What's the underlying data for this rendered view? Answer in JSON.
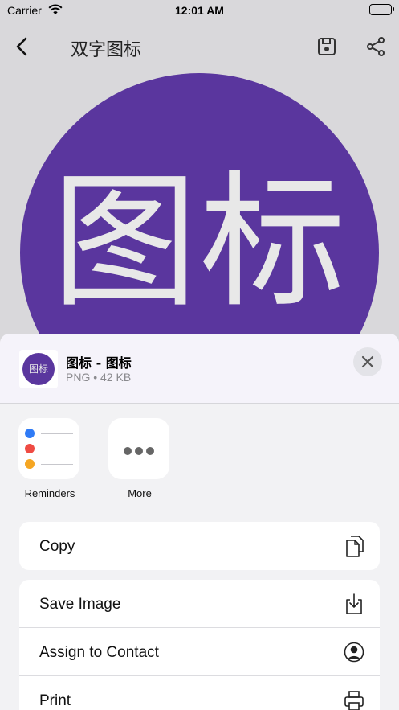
{
  "status_bar": {
    "carrier": "Carrier",
    "time": "12:01 AM"
  },
  "nav": {
    "title": "双字图标",
    "icons": [
      "chevron-left-icon",
      "save-icon",
      "share-icon"
    ]
  },
  "preview": {
    "glyphs": "图标",
    "circle_color": "#5a369e"
  },
  "share_sheet": {
    "file_name": "图标 - 图标",
    "file_meta": "PNG • 42 KB",
    "thumb_text": "图标",
    "apps": [
      {
        "label": "Reminders"
      },
      {
        "label": "More"
      }
    ],
    "actions": [
      {
        "label": "Copy",
        "icon": "copy-icon"
      },
      {
        "label": "Save Image",
        "icon": "download-icon"
      },
      {
        "label": "Assign to Contact",
        "icon": "contact-icon"
      },
      {
        "label": "Print",
        "icon": "printer-icon"
      }
    ]
  }
}
